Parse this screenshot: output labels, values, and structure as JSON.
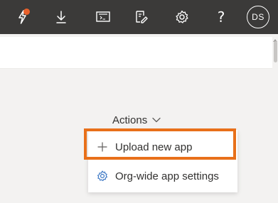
{
  "topbar": {
    "icons": [
      "lightning-icon",
      "download-icon",
      "terminal-icon",
      "feedback-icon",
      "gear-icon",
      "help-icon"
    ],
    "help_label": "?",
    "avatar_initials": "DS",
    "badge_color": "#e8612c",
    "background_color": "#3b3a39"
  },
  "actions": {
    "label": "Actions"
  },
  "menu": {
    "items": [
      {
        "label": "Upload new app",
        "icon": "plus-icon"
      },
      {
        "label": "Org-wide app settings",
        "icon": "gear-icon"
      }
    ]
  },
  "highlight_color": "#e8701a"
}
